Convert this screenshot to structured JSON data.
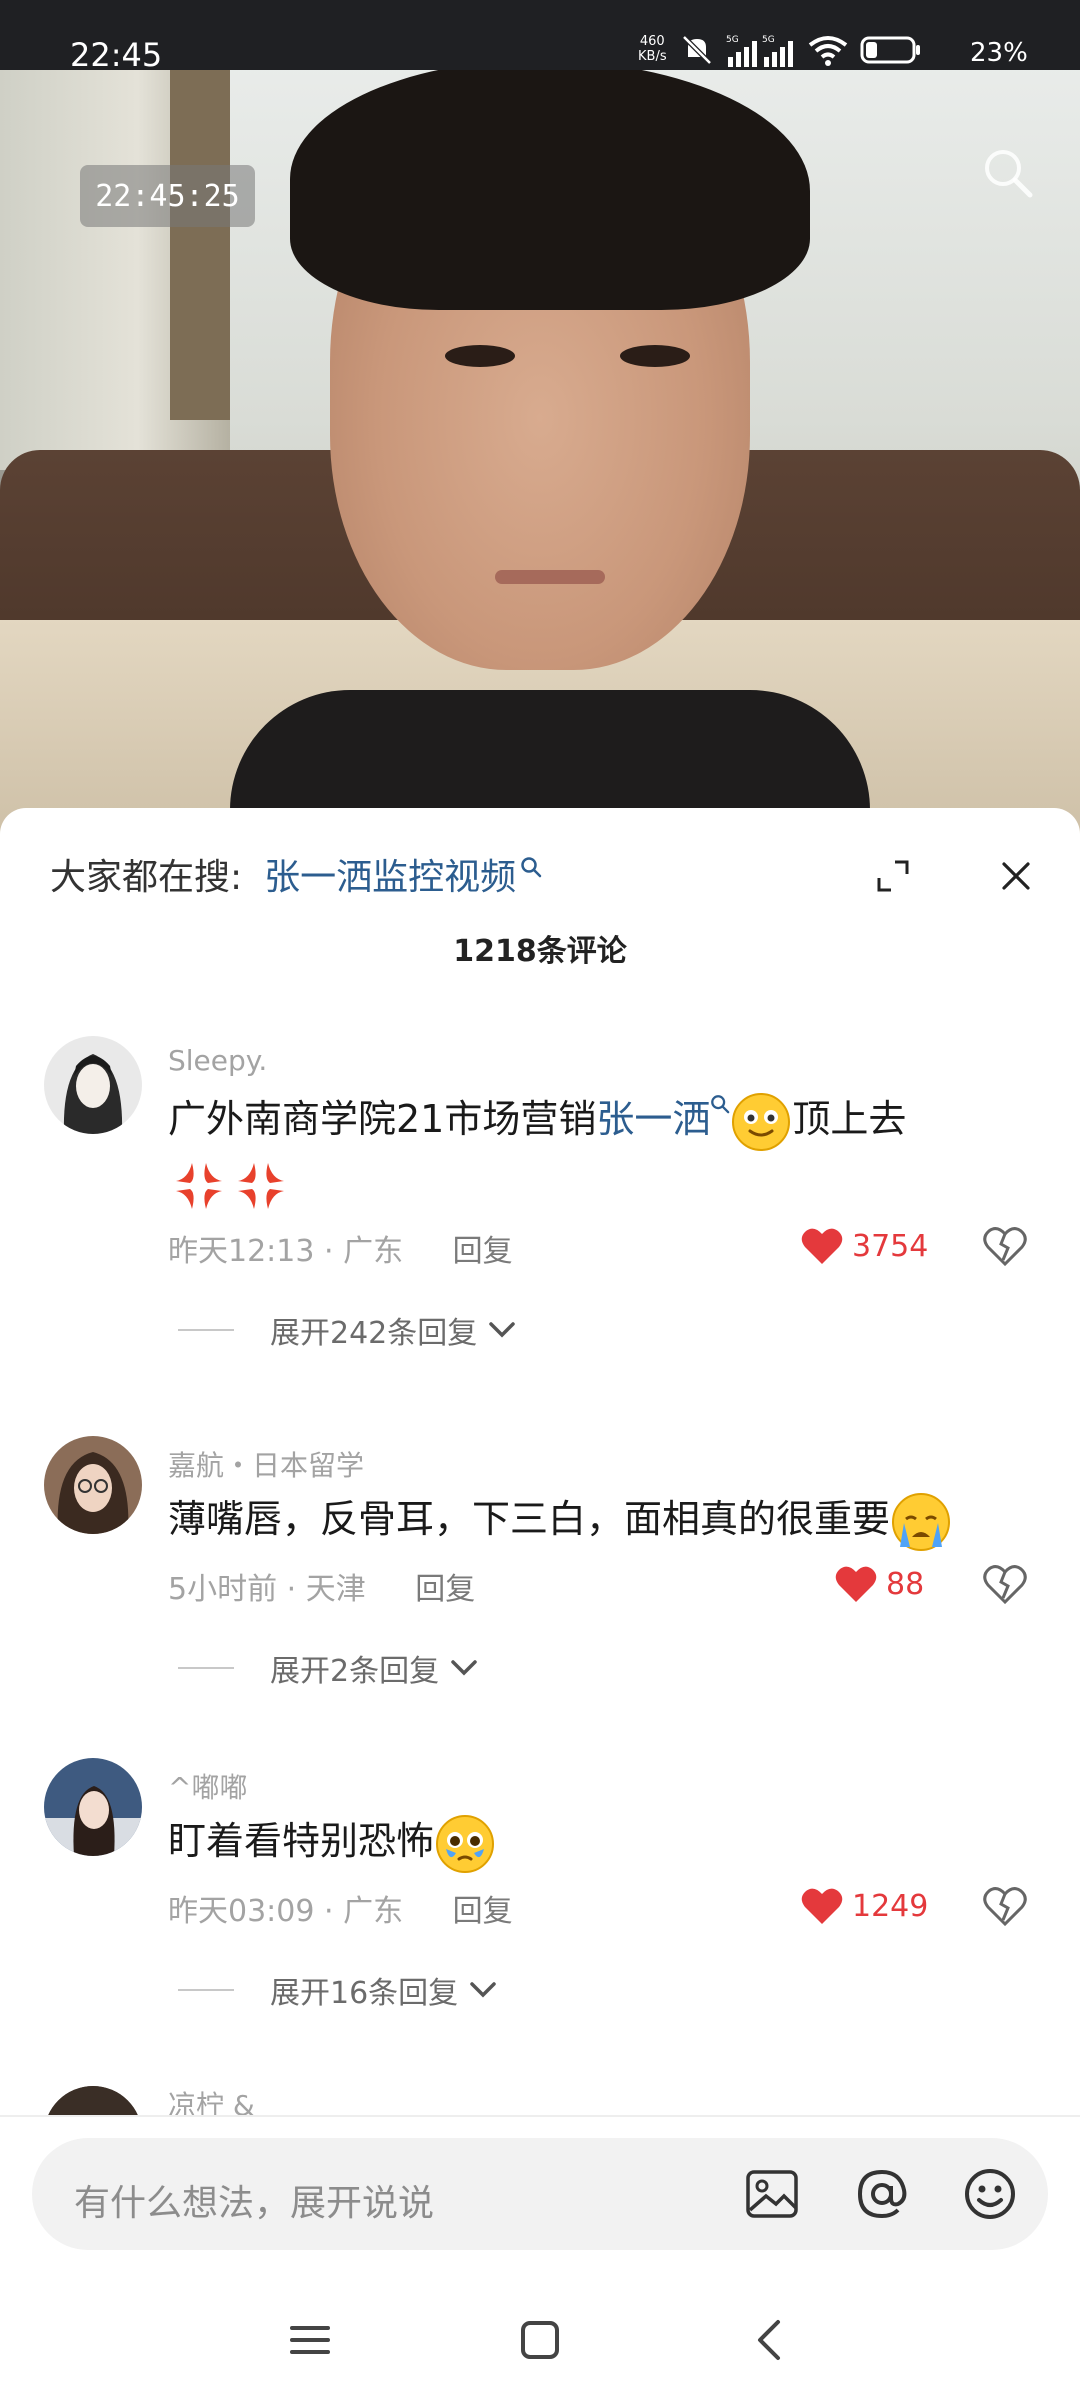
{
  "status_bar": {
    "time": "22:45",
    "network_speed": "460\nKB/s",
    "battery": "23%"
  },
  "video": {
    "timestamp": "22:45:25"
  },
  "sheet": {
    "hot_search_label": "大家都在搜:",
    "hot_search_query": "张一洒监控视频",
    "comment_count": "1218条评论"
  },
  "comments": [
    {
      "username": "Sleepy.",
      "text_prefix": "广外南商学院21市场营销",
      "text_link": "张一洒",
      "text_suffix": "顶上去",
      "emojis": [
        "smiling-face",
        "anger-symbol",
        "anger-symbol"
      ],
      "time": "昨天12:13",
      "location": "广东",
      "reply_label": "回复",
      "likes": "3754",
      "expand_label": "展开242条回复"
    },
    {
      "username": "嘉航・日本留学",
      "text": "薄嘴唇，反骨耳，下三白，面相真的很重要",
      "emojis": [
        "crying-face"
      ],
      "time": "5小时前",
      "location": "天津",
      "reply_label": "回复",
      "likes": "88",
      "expand_label": "展开2条回复"
    },
    {
      "username": "^嘟嘟",
      "text": "盯着看特别恐怖",
      "emojis": [
        "pleading-tears-face"
      ],
      "time": "昨天03:09",
      "location": "广东",
      "reply_label": "回复",
      "likes": "1249",
      "expand_label": "展开16条回复"
    },
    {
      "username": "凉柠 &"
    }
  ],
  "input_bar": {
    "placeholder": "有什么想法，展开说说"
  },
  "colors": {
    "link_blue": "#2c5d8f",
    "like_red": "#e4393c",
    "meta_gray": "#a3a3a3"
  },
  "icons": [
    "search-icon",
    "expand-icon",
    "close-icon",
    "heart-icon",
    "dislike-heart-icon",
    "chevron-down-icon",
    "image-icon",
    "at-icon",
    "emoji-icon",
    "menu-icon",
    "home-icon",
    "back-icon"
  ]
}
